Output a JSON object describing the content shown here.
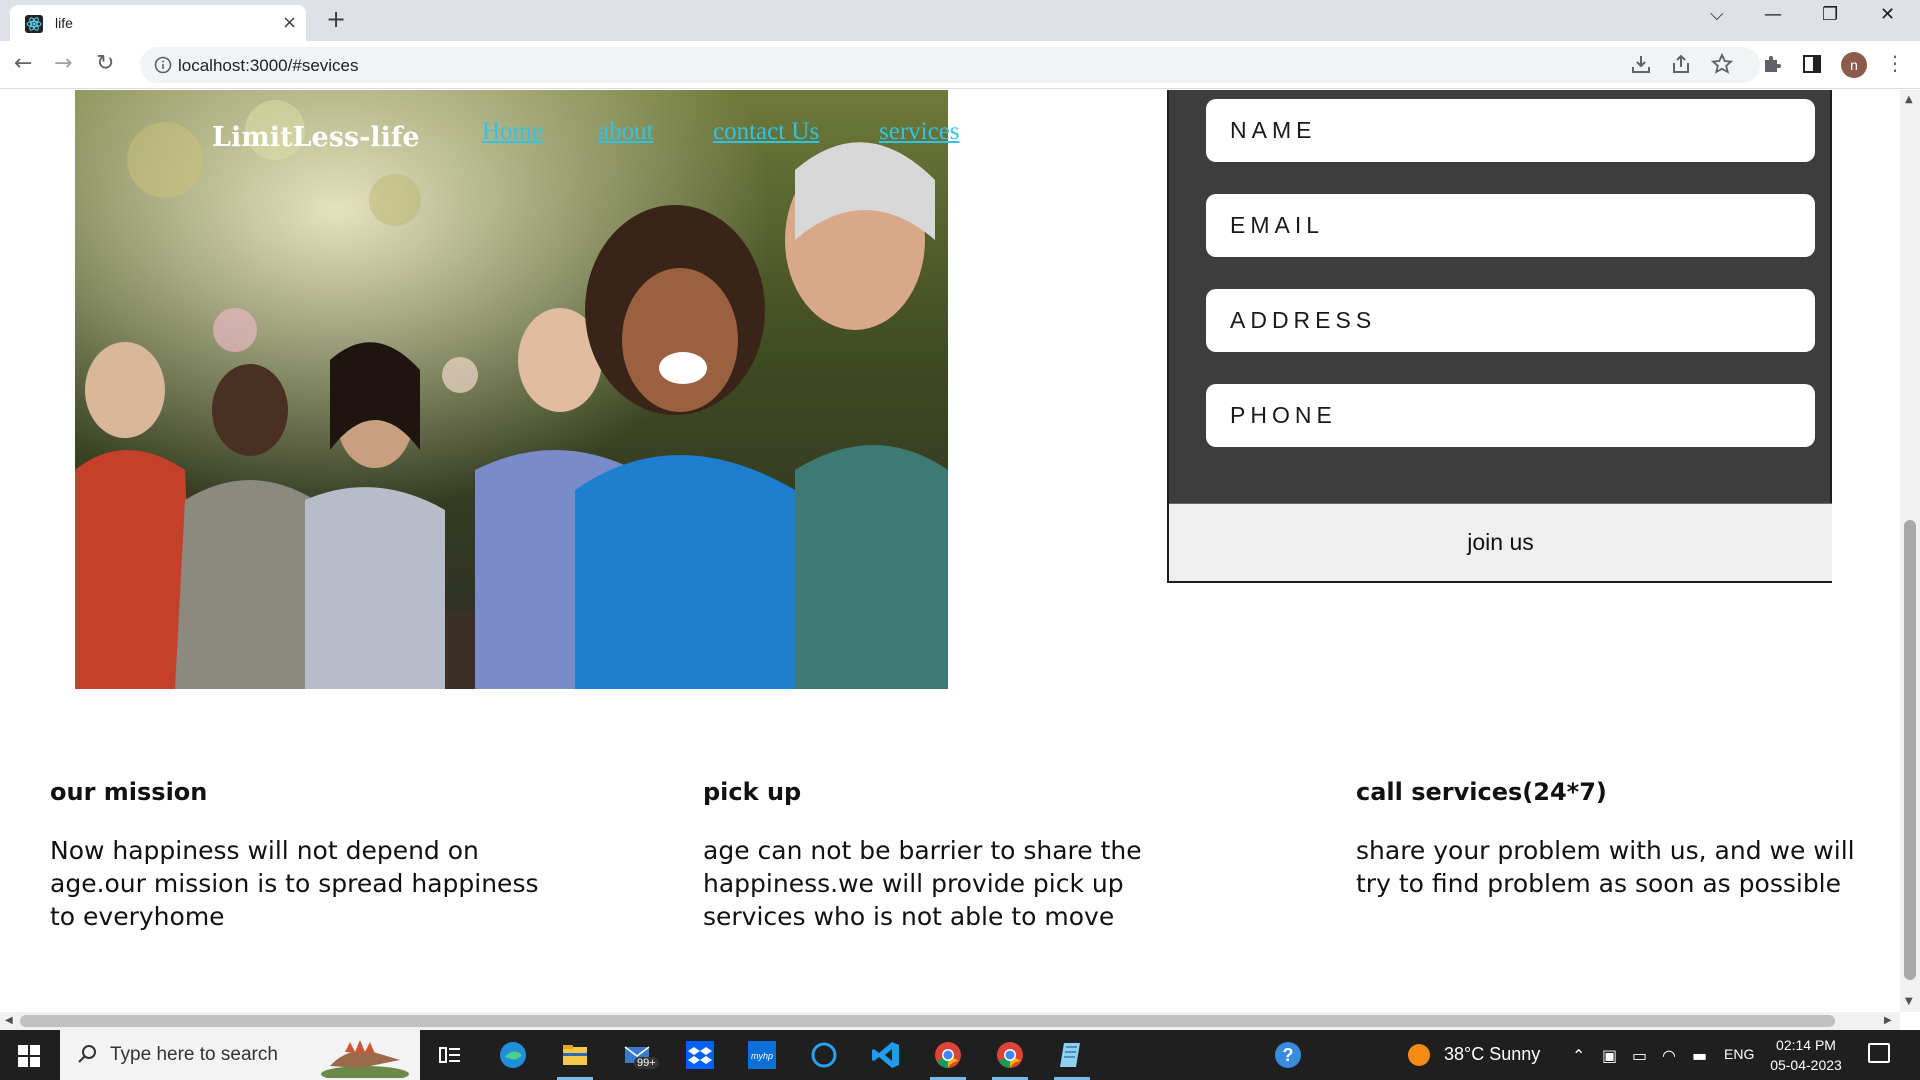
{
  "browser": {
    "tab_title": "life",
    "new_tab_symbol": "+",
    "close_symbol": "×",
    "url": "localhost:3000/#sevices",
    "profile_initial": "n"
  },
  "site": {
    "logo": "LimitLess-life",
    "nav": [
      {
        "label": "Home"
      },
      {
        "label": "about"
      },
      {
        "label": "contact Us"
      },
      {
        "label": "services"
      }
    ]
  },
  "form": {
    "name_placeholder": "NAME",
    "email_placeholder": "EMAIL",
    "address_placeholder": "ADDRESS",
    "phone_placeholder": "PHONE",
    "submit_label": "join us"
  },
  "sections": [
    {
      "title": "our mission",
      "text": "Now happiness will not depend on age.our mission is to spread happiness to everyhome"
    },
    {
      "title": "pick up",
      "text": "age can not be barrier to share the happiness.we will provide pick up services who is not able to move"
    },
    {
      "title": "call services(24*7)",
      "text": "share your problem with us, and we will try to find problem as soon as possible"
    }
  ],
  "taskbar": {
    "search_placeholder": "Type here to search",
    "mail_badge": "99+",
    "weather": "38°C  Sunny",
    "language": "ENG",
    "time": "02:14 PM",
    "date": "05-04-2023"
  },
  "colors": {
    "nav_link": "#2ec4ea",
    "form_bg": "#3d3d3d",
    "taskbar_bg": "#1f1f1f"
  }
}
